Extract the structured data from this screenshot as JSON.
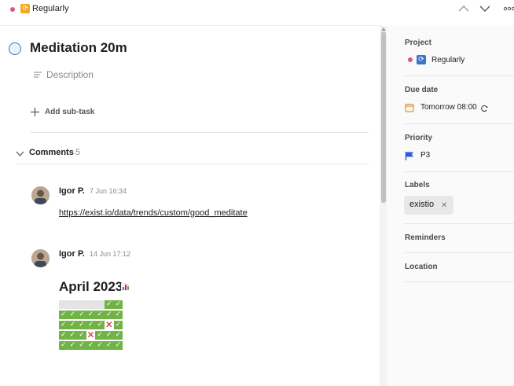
{
  "topbar": {
    "project_name": "Regularly",
    "recurring_emoji": "🔁",
    "dot_color": "#e05194"
  },
  "task": {
    "title": "Meditation 20m",
    "description_placeholder": "Description",
    "add_subtask_label": "Add sub-task"
  },
  "comments": {
    "label": "Comments",
    "count": "5",
    "items": [
      {
        "author": "Igor P.",
        "timestamp": "7 Jun 16:34",
        "link": "https://exist.io/data/trends/custom/good_meditate"
      },
      {
        "author": "Igor P.",
        "timestamp": "14 Jun 17:12",
        "heading": "April 2023",
        "heading_emoji": "bar-chart-icon",
        "grid_rows": [
          [
            "empty",
            "empty",
            "empty",
            "empty",
            "empty",
            "ok",
            "ok"
          ],
          [
            "ok",
            "ok",
            "ok",
            "ok",
            "ok",
            "ok",
            "ok"
          ],
          [
            "ok",
            "ok",
            "ok",
            "ok",
            "ok",
            "x",
            "ok"
          ],
          [
            "ok",
            "ok",
            "ok",
            "x",
            "ok",
            "ok",
            "ok"
          ],
          [
            "ok",
            "ok",
            "ok",
            "ok",
            "ok",
            "ok",
            "ok"
          ]
        ]
      }
    ]
  },
  "sidebar": {
    "project_label": "Project",
    "project_value": "Regularly",
    "due_label": "Due date",
    "due_value": "Tomorrow 08:00",
    "priority_label": "Priority",
    "priority_value": "P3",
    "labels_label": "Labels",
    "label_chip": "existio",
    "reminders_label": "Reminders",
    "location_label": "Location"
  },
  "colors": {
    "accent_blue": "#3b74c9",
    "check_green": "#71b347",
    "cross_red": "#d0243a"
  }
}
